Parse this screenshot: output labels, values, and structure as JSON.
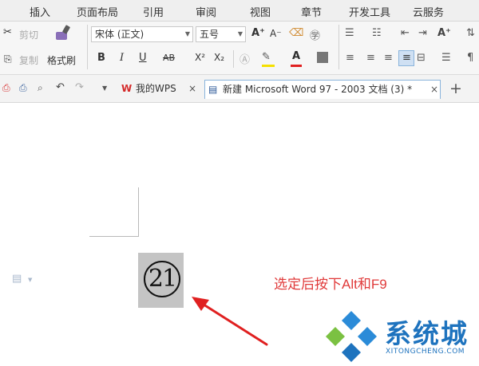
{
  "menu": [
    "插入",
    "页面布局",
    "引用",
    "审阅",
    "视图",
    "章节",
    "开发工具",
    "云服务"
  ],
  "ribbon": {
    "cut": "剪切",
    "copy": "复制",
    "format_painter": "格式刷",
    "font_name": "宋体 (正文)",
    "font_size": "五号",
    "bold": "B",
    "italic": "I",
    "underline": "U",
    "strike": "AB",
    "superscript": "X²",
    "subscript": "X₂",
    "grow_font": "A⁺",
    "shrink_font": "A⁻",
    "font_color": "A"
  },
  "tabs": {
    "home_tab": "我的WPS",
    "doc_tab": "新建 Microsoft Word 97 - 2003 文档 (3) *",
    "close": "×",
    "new": "+"
  },
  "document": {
    "enclosed_char": "21",
    "annotation": "选定后按下Alt和F9"
  },
  "watermark": {
    "text": "系统城",
    "url": "XITONGCHENG.COM"
  },
  "colors": {
    "annotation": "#e03a3a",
    "arrow": "#e02020",
    "logo_blue": "#1e73be",
    "logo_green": "#7bc142"
  }
}
